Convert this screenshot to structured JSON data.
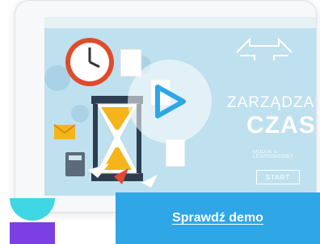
{
  "video_thumbnail": {
    "title_line1": "ZARZĄDZANIE",
    "title_line2": "CZASEM",
    "subtitle": "MODUŁ E-LEARNINGOWY",
    "start_label": "START"
  },
  "play_button": {
    "icon": "play-icon",
    "color": "#2fa6e6"
  },
  "cta": {
    "label": "Sprawdź demo",
    "color": "#2fa6e6"
  },
  "colors": {
    "screen_background": "#bfe0ee",
    "brand_gradient_top": "#3fd6e6",
    "brand_gradient_bottom": "#7b3fe4"
  }
}
